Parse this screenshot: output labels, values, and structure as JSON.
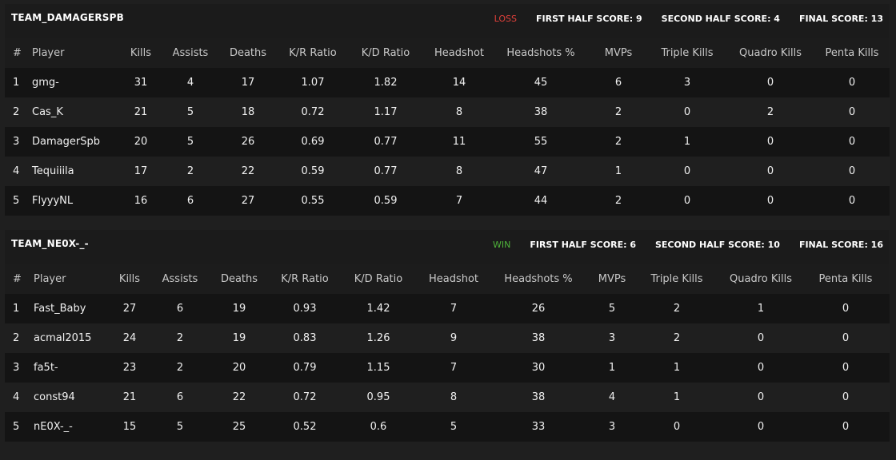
{
  "columns": [
    "#",
    "Player",
    "Kills",
    "Assists",
    "Deaths",
    "K/R Ratio",
    "K/D Ratio",
    "Headshot",
    "Headshots %",
    "MVPs",
    "Triple Kills",
    "Quadro Kills",
    "Penta Kills"
  ],
  "colors": {
    "loss": "#e0403a",
    "win": "#4fb43a"
  },
  "teams": [
    {
      "name": "TEAM_DAMAGERSPB",
      "result": "LOSS",
      "first_half": "FIRST HALF SCORE: 9",
      "second_half": "SECOND HALF SCORE: 4",
      "final": "FINAL SCORE: 13",
      "rows": [
        [
          "1",
          "gmg-",
          "31",
          "4",
          "17",
          "1.07",
          "1.82",
          "14",
          "45",
          "6",
          "3",
          "0",
          "0"
        ],
        [
          "2",
          "Cas_K",
          "21",
          "5",
          "18",
          "0.72",
          "1.17",
          "8",
          "38",
          "2",
          "0",
          "2",
          "0"
        ],
        [
          "3",
          "DamagerSpb",
          "20",
          "5",
          "26",
          "0.69",
          "0.77",
          "11",
          "55",
          "2",
          "1",
          "0",
          "0"
        ],
        [
          "4",
          "Tequiiila",
          "17",
          "2",
          "22",
          "0.59",
          "0.77",
          "8",
          "47",
          "1",
          "0",
          "0",
          "0"
        ],
        [
          "5",
          "FlyyyNL",
          "16",
          "6",
          "27",
          "0.55",
          "0.59",
          "7",
          "44",
          "2",
          "0",
          "0",
          "0"
        ]
      ]
    },
    {
      "name": "TEAM_NE0X-_-",
      "result": "WIN",
      "first_half": "FIRST HALF SCORE: 6",
      "second_half": "SECOND HALF SCORE: 10",
      "final": "FINAL SCORE: 16",
      "rows": [
        [
          "1",
          "Fast_Baby",
          "27",
          "6",
          "19",
          "0.93",
          "1.42",
          "7",
          "26",
          "5",
          "2",
          "1",
          "0"
        ],
        [
          "2",
          "acmal2015",
          "24",
          "2",
          "19",
          "0.83",
          "1.26",
          "9",
          "38",
          "3",
          "2",
          "0",
          "0"
        ],
        [
          "3",
          "fa5t-",
          "23",
          "2",
          "20",
          "0.79",
          "1.15",
          "7",
          "30",
          "1",
          "1",
          "0",
          "0"
        ],
        [
          "4",
          "const94",
          "21",
          "6",
          "22",
          "0.72",
          "0.95",
          "8",
          "38",
          "4",
          "1",
          "0",
          "0"
        ],
        [
          "5",
          "nE0X-_-",
          "15",
          "5",
          "25",
          "0.52",
          "0.6",
          "5",
          "33",
          "3",
          "0",
          "0",
          "0"
        ]
      ]
    }
  ]
}
